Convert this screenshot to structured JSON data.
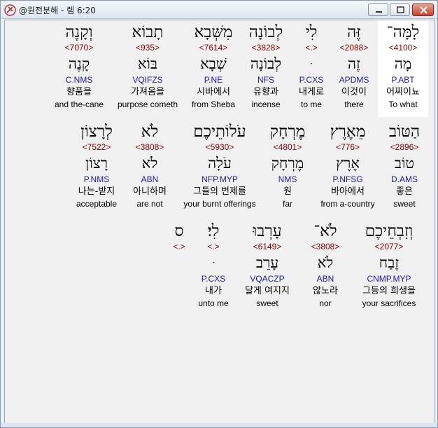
{
  "window": {
    "title": "@원전분해 - 렘 6:20",
    "colors": {
      "hebrew": "#000000",
      "strongs": "#8b0000",
      "parsing": "#1a1ab0",
      "highlight": "#ffffff"
    }
  },
  "rows": [
    {
      "words": [
        {
          "heb": "לָמָּה־",
          "num": "<4100>",
          "lex": "מָה",
          "pars": "P.ABT",
          "kor": "어찌이뇨",
          "eng": "To what"
        },
        {
          "heb": "זֶּה",
          "num": "<2088>",
          "lex": "זֶה",
          "pars": "APDMS",
          "kor": "이것이",
          "eng": "there"
        },
        {
          "heb": "לִי",
          "num": "<.>",
          "lex": "ּ",
          "pars": "P.CXS",
          "kor": "내게로",
          "eng": "to me"
        },
        {
          "heb": "לְבוֹנָה",
          "num": "<3828>",
          "lex": "לְבוֹנָה",
          "pars": "NFS",
          "kor": "유향과",
          "eng": "incense"
        },
        {
          "heb": "מִשְּׁבָא",
          "num": "<7614>",
          "lex": "שְׁבָא",
          "pars": "P.NE",
          "kor": "시바에서",
          "eng": "from Sheba"
        },
        {
          "heb": "תָבוֹא",
          "num": "<935>",
          "lex": "בּוֹא",
          "pars": "VQIFZS",
          "kor": "가져옴을",
          "eng": "purpose cometh"
        },
        {
          "heb": "וְקָנֶה",
          "num": "<7070>",
          "lex": "קָנֶה",
          "pars": "C.NMS",
          "kor": "향품을",
          "eng": "and the-cane"
        }
      ]
    },
    {
      "words": [
        {
          "heb": "הַטּוֹב",
          "num": "<2896>",
          "lex": "טוֹב",
          "pars": "D.AMS",
          "kor": "좋은",
          "eng": "sweet"
        },
        {
          "heb": "מֵאֶרֶץ",
          "num": "<776>",
          "lex": "אֶרֶץ",
          "pars": "P.NFSG",
          "kor": "바아에서",
          "eng": "from a-country"
        },
        {
          "heb": "מֶרְחָק",
          "num": "<4801>",
          "lex": "מֶרְחָק",
          "pars": "NMS",
          "kor": "원",
          "eng": "far"
        },
        {
          "heb": "עֹלוֹתֵיכֶם",
          "num": "<5930>",
          "lex": "עֹלָה",
          "pars": "NFP.MYP",
          "kor": "그들의 번제를",
          "eng": "your burnt offerings"
        },
        {
          "heb": "לֹא",
          "num": "<3808>",
          "lex": "לֹא",
          "pars": "ABN",
          "kor": "아니하며",
          "eng": "are not"
        },
        {
          "heb": "לְרָצוֹן",
          "num": "<7522>",
          "lex": "רָצוֹן",
          "pars": "P.NMS",
          "kor": "나는-받지",
          "eng": "acceptable"
        }
      ]
    },
    {
      "words": [
        {
          "heb": "וְזִבְחֵיכֶם",
          "num": "<2077>",
          "lex": "זֶבַח",
          "pars": "CNMP.MYP",
          "kor": "그등의 희생을",
          "eng": "your sacrifices"
        },
        {
          "heb": "לֹא־",
          "num": "<3808>",
          "lex": "לֹא",
          "pars": "ABN",
          "kor": "않노라",
          "eng": "nor"
        },
        {
          "heb": "עָרְבוּ",
          "num": "<6149>",
          "lex": "עָרֵב",
          "pars": "VQACZP",
          "kor": "달게 여지지",
          "eng": "sweet"
        },
        {
          "heb": "לִי׃",
          "num": "<.>",
          "lex": "ּ",
          "pars": "P.CXS",
          "kor": "내가",
          "eng": "unto me"
        },
        {
          "heb": "ס",
          "num": "<.>",
          "lex": "",
          "pars": "",
          "kor": "",
          "eng": ""
        }
      ]
    }
  ]
}
